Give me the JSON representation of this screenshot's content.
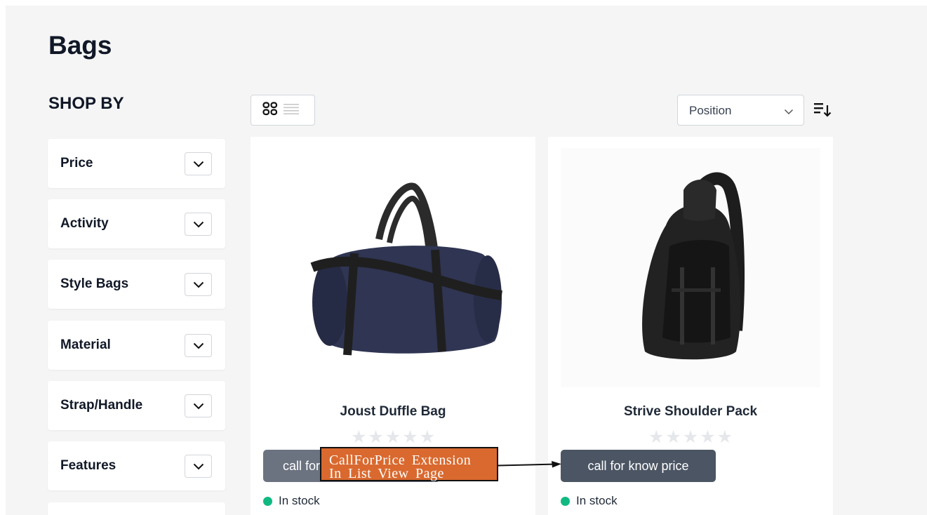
{
  "page": {
    "title": "Bags"
  },
  "sidebar": {
    "title": "SHOP BY",
    "filters": [
      {
        "label": "Price"
      },
      {
        "label": "Activity"
      },
      {
        "label": "Style Bags"
      },
      {
        "label": "Material"
      },
      {
        "label": "Strap/Handle"
      },
      {
        "label": "Features"
      }
    ]
  },
  "toolbar": {
    "view_modes": [
      "grid-icon",
      "list-icon"
    ],
    "sorter": {
      "selected": "Position"
    }
  },
  "products": [
    {
      "name": "Joust Duffle Bag",
      "price_button": "call for know price",
      "stock": "In stock",
      "rating": 0
    },
    {
      "name": "Strive Shoulder Pack",
      "price_button": "call for know price",
      "stock": "In stock",
      "rating": 0
    }
  ],
  "annotation": {
    "line1": "CallForPrice Extension",
    "line2": "In List View Page"
  },
  "colors": {
    "page_bg": "#f5f5f5",
    "button_bg": "#4b5563",
    "stock_dot": "#10b981",
    "annotation_bg": "#d9692f"
  }
}
